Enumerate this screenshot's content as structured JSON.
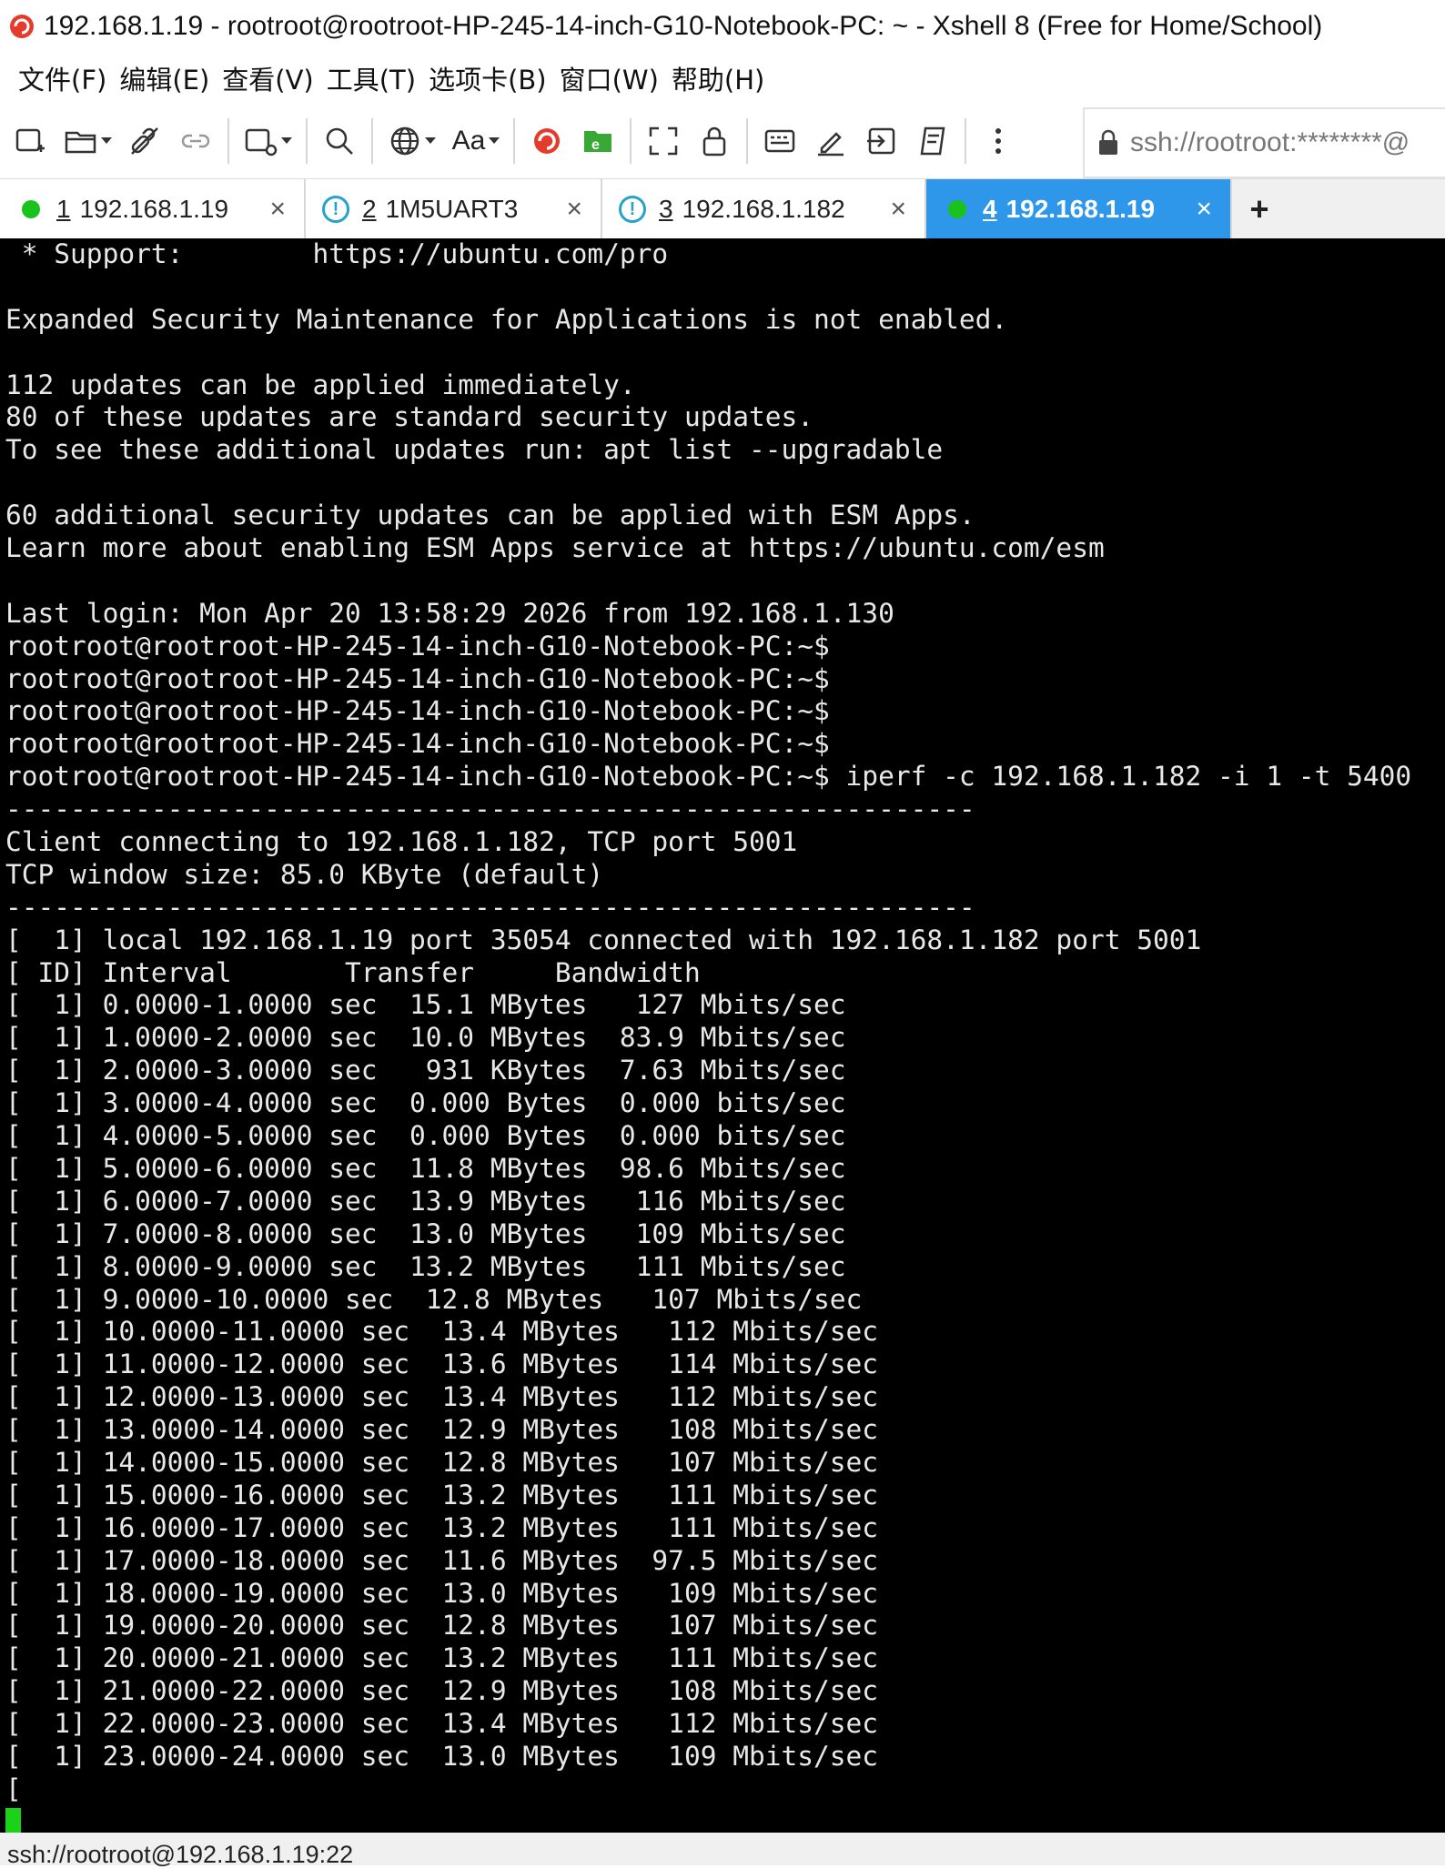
{
  "window": {
    "title": "192.168.1.19 - rootroot@rootroot-HP-245-14-inch-G10-Notebook-PC: ~ - Xshell 8 (Free for Home/School)",
    "accent_color": "#2f97ea"
  },
  "menu": {
    "items": [
      "文件(F)",
      "编辑(E)",
      "查看(V)",
      "工具(T)",
      "选项卡(B)",
      "窗口(W)",
      "帮助(H)"
    ]
  },
  "toolbar": {
    "font_label": "Aa",
    "icons": [
      "new-session-icon",
      "open-folder-icon",
      "disconnect-icon",
      "reconnect-icon",
      "new-tab-settings-icon",
      "find-icon",
      "globe-icon",
      "font-icon",
      "xshell-icon",
      "xftp-icon",
      "fullscreen-icon",
      "lock-icon",
      "keyboard-icon",
      "compose-icon",
      "transfer-icon",
      "script-icon",
      "more-icon"
    ],
    "address": "ssh://rootroot:********@"
  },
  "tabs": [
    {
      "num": "1",
      "label": "192.168.1.19",
      "status": "connected"
    },
    {
      "num": "2",
      "label": "1M5UART3",
      "status": "warning"
    },
    {
      "num": "3",
      "label": "192.168.1.182",
      "status": "warning"
    },
    {
      "num": "4",
      "label": "192.168.1.19",
      "status": "connected",
      "active": true
    }
  ],
  "tab_add_label": "+",
  "tab_close_label": "×",
  "terminal": {
    "lines": [
      " * Support:        https://ubuntu.com/pro",
      "",
      "Expanded Security Maintenance for Applications is not enabled.",
      "",
      "112 updates can be applied immediately.",
      "80 of these updates are standard security updates.",
      "To see these additional updates run: apt list --upgradable",
      "",
      "60 additional security updates can be applied with ESM Apps.",
      "Learn more about enabling ESM Apps service at https://ubuntu.com/esm",
      "",
      "Last login: Mon Apr 20 13:58:29 2026 from 192.168.1.130",
      "rootroot@rootroot-HP-245-14-inch-G10-Notebook-PC:~$",
      "rootroot@rootroot-HP-245-14-inch-G10-Notebook-PC:~$",
      "rootroot@rootroot-HP-245-14-inch-G10-Notebook-PC:~$",
      "rootroot@rootroot-HP-245-14-inch-G10-Notebook-PC:~$",
      "rootroot@rootroot-HP-245-14-inch-G10-Notebook-PC:~$ iperf -c 192.168.1.182 -i 1 -t 5400",
      "------------------------------------------------------------",
      "Client connecting to 192.168.1.182, TCP port 5001",
      "TCP window size: 85.0 KByte (default)",
      "------------------------------------------------------------",
      "[  1] local 192.168.1.19 port 35054 connected with 192.168.1.182 port 5001",
      "[ ID] Interval       Transfer     Bandwidth",
      "[  1] 0.0000-1.0000 sec  15.1 MBytes   127 Mbits/sec",
      "[  1] 1.0000-2.0000 sec  10.0 MBytes  83.9 Mbits/sec",
      "[  1] 2.0000-3.0000 sec   931 KBytes  7.63 Mbits/sec",
      "[  1] 3.0000-4.0000 sec  0.000 Bytes  0.000 bits/sec",
      "[  1] 4.0000-5.0000 sec  0.000 Bytes  0.000 bits/sec",
      "[  1] 5.0000-6.0000 sec  11.8 MBytes  98.6 Mbits/sec",
      "[  1] 6.0000-7.0000 sec  13.9 MBytes   116 Mbits/sec",
      "[  1] 7.0000-8.0000 sec  13.0 MBytes   109 Mbits/sec",
      "[  1] 8.0000-9.0000 sec  13.2 MBytes   111 Mbits/sec",
      "[  1] 9.0000-10.0000 sec  12.8 MBytes   107 Mbits/sec",
      "[  1] 10.0000-11.0000 sec  13.4 MBytes   112 Mbits/sec",
      "[  1] 11.0000-12.0000 sec  13.6 MBytes   114 Mbits/sec",
      "[  1] 12.0000-13.0000 sec  13.4 MBytes   112 Mbits/sec",
      "[  1] 13.0000-14.0000 sec  12.9 MBytes   108 Mbits/sec",
      "[  1] 14.0000-15.0000 sec  12.8 MBytes   107 Mbits/sec",
      "[  1] 15.0000-16.0000 sec  13.2 MBytes   111 Mbits/sec",
      "[  1] 16.0000-17.0000 sec  13.2 MBytes   111 Mbits/sec",
      "[  1] 17.0000-18.0000 sec  11.6 MBytes  97.5 Mbits/sec",
      "[  1] 18.0000-19.0000 sec  13.0 MBytes   109 Mbits/sec",
      "[  1] 19.0000-20.0000 sec  12.8 MBytes   107 Mbits/sec",
      "[  1] 20.0000-21.0000 sec  13.2 MBytes   111 Mbits/sec",
      "[  1] 21.0000-22.0000 sec  12.9 MBytes   108 Mbits/sec",
      "[  1] 22.0000-23.0000 sec  13.4 MBytes   112 Mbits/sec",
      "[  1] 23.0000-24.0000 sec  13.0 MBytes   109 Mbits/sec",
      "["
    ],
    "cursor_color": "#19d219"
  },
  "status": {
    "text": "ssh://rootroot@192.168.1.19:22"
  }
}
